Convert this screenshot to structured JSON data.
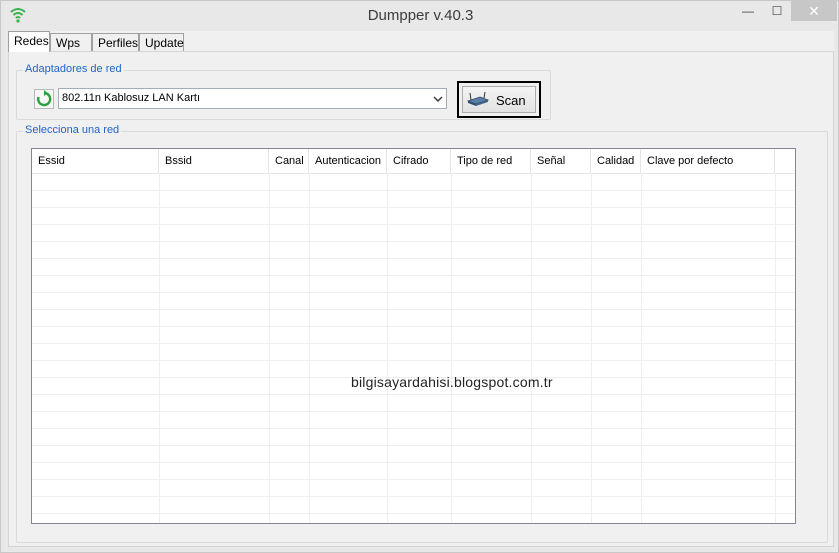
{
  "window": {
    "title": "Dumpper v.40.3",
    "minimize_glyph": "—",
    "maximize_glyph": "☐",
    "close_glyph": "✕"
  },
  "tabs": [
    {
      "label": "Redes",
      "active": true
    },
    {
      "label": "Wps",
      "active": false
    },
    {
      "label": "Perfiles",
      "active": false
    },
    {
      "label": "Update",
      "active": false
    }
  ],
  "adapters": {
    "legend": "Adaptadores de red",
    "selected": "802.11n Kablosuz LAN Kartı",
    "scan_label": "Scan"
  },
  "networks": {
    "legend": "Selecciona una red",
    "columns": [
      "Essid",
      "Bssid",
      "Canal",
      "Autenticacion",
      "Cifrado",
      "Tipo de red",
      "Señal",
      "Calidad",
      "Clave por defecto"
    ],
    "rows": []
  },
  "watermark": "bilgisayardahisi.blogspot.com.tr",
  "icons": {
    "app": "wifi-signal-icon",
    "refresh": "refresh-icon",
    "scan": "router-icon",
    "dropdown": "chevron-down-icon"
  },
  "colors": {
    "legend": "#1e64c8",
    "close_button": "#c7c7c7"
  }
}
